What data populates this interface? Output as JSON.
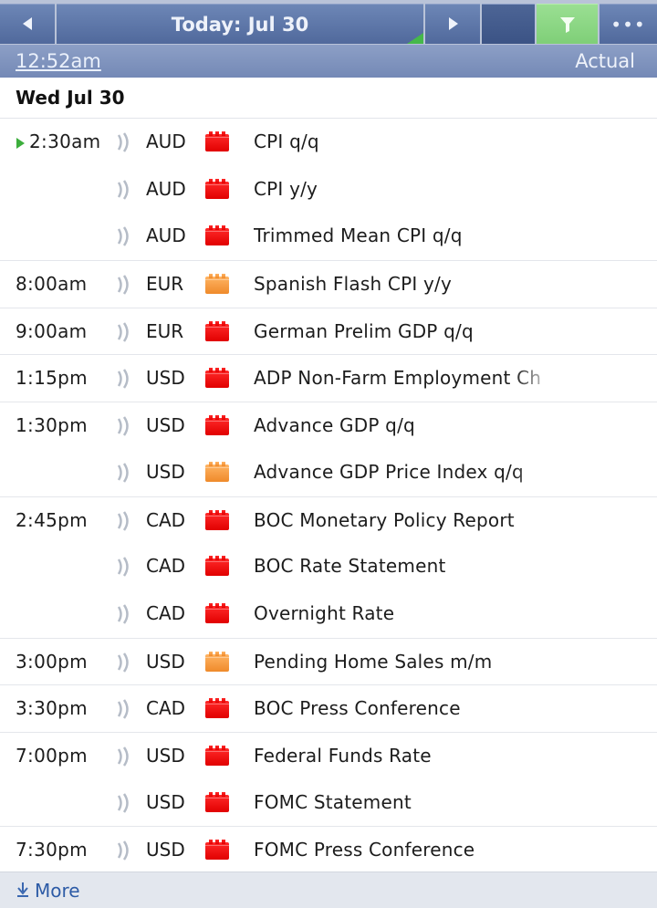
{
  "nav": {
    "title": "Today: Jul 30",
    "more_label": "•••",
    "filter_color": "#8fd986"
  },
  "header": {
    "current_time": "12:52am",
    "column_label": "Actual"
  },
  "date_heading": "Wed Jul 30",
  "events": [
    {
      "time": "2:30am",
      "currency": "AUD",
      "impact": "high",
      "event": "CPI q/q",
      "current": true
    },
    {
      "time": "",
      "currency": "AUD",
      "impact": "high",
      "event": "CPI y/y"
    },
    {
      "time": "",
      "currency": "AUD",
      "impact": "high",
      "event": "Trimmed Mean CPI q/q"
    },
    {
      "time": "8:00am",
      "currency": "EUR",
      "impact": "medium",
      "event": "Spanish Flash CPI y/y"
    },
    {
      "time": "9:00am",
      "currency": "EUR",
      "impact": "high",
      "event": "German Prelim GDP q/q"
    },
    {
      "time": "1:15pm",
      "currency": "USD",
      "impact": "high",
      "event": "ADP Non-Farm Employment Ch"
    },
    {
      "time": "1:30pm",
      "currency": "USD",
      "impact": "high",
      "event": "Advance GDP q/q"
    },
    {
      "time": "",
      "currency": "USD",
      "impact": "medium",
      "event": "Advance GDP Price Index q/q"
    },
    {
      "time": "2:45pm",
      "currency": "CAD",
      "impact": "high",
      "event": "BOC Monetary Policy Report"
    },
    {
      "time": "",
      "currency": "CAD",
      "impact": "high",
      "event": "BOC Rate Statement"
    },
    {
      "time": "",
      "currency": "CAD",
      "impact": "high",
      "event": "Overnight Rate"
    },
    {
      "time": "3:00pm",
      "currency": "USD",
      "impact": "medium",
      "event": "Pending Home Sales m/m"
    },
    {
      "time": "3:30pm",
      "currency": "CAD",
      "impact": "high",
      "event": "BOC Press Conference"
    },
    {
      "time": "7:00pm",
      "currency": "USD",
      "impact": "high",
      "event": "Federal Funds Rate"
    },
    {
      "time": "",
      "currency": "USD",
      "impact": "high",
      "event": "FOMC Statement"
    },
    {
      "time": "7:30pm",
      "currency": "USD",
      "impact": "high",
      "event": "FOMC Press Conference"
    }
  ],
  "impact_colors": {
    "high": "#f00a0a",
    "medium": "#f59a3d"
  },
  "footer": {
    "more_label": "More"
  }
}
